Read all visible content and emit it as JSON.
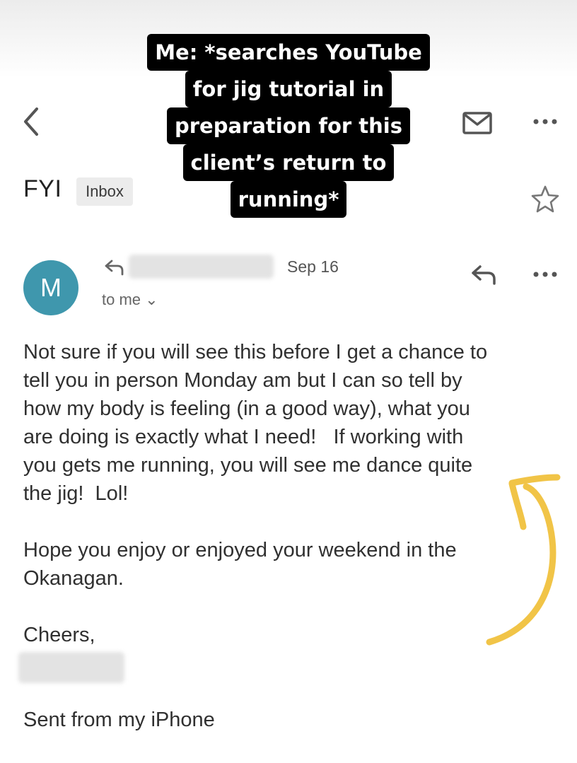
{
  "caption": {
    "lines": [
      "Me: *searches YouTube",
      "for jig tutorial in",
      "preparation for this",
      "client’s return to",
      "running*"
    ]
  },
  "header": {
    "back_icon": "back-chevron-icon",
    "archive_icon": "mail-icon",
    "more_icon": "more-horizontal-icon"
  },
  "email": {
    "subject": "FYI",
    "label": "Inbox",
    "star_icon": "star-outline-icon",
    "avatar_letter": "M",
    "avatar_color": "#3f97ad",
    "date": "Sep 16",
    "to_line": "to me ⌄",
    "body": [
      "Not sure if you will see this before I get a chance to",
      "tell you in person Monday am but I can so tell by",
      "how my body is feeling (in a good way), what you",
      "are doing is exactly what I need!   If working with",
      "you gets me running, you will see me dance quite",
      "the jig!  Lol!"
    ],
    "body2": [
      "Hope you enjoy or enjoyed your weekend in the",
      "Okanagan."
    ],
    "signoff": "Cheers,",
    "footer": "Sent from my iPhone"
  },
  "annotation": {
    "arrow_color": "#f1c447"
  }
}
